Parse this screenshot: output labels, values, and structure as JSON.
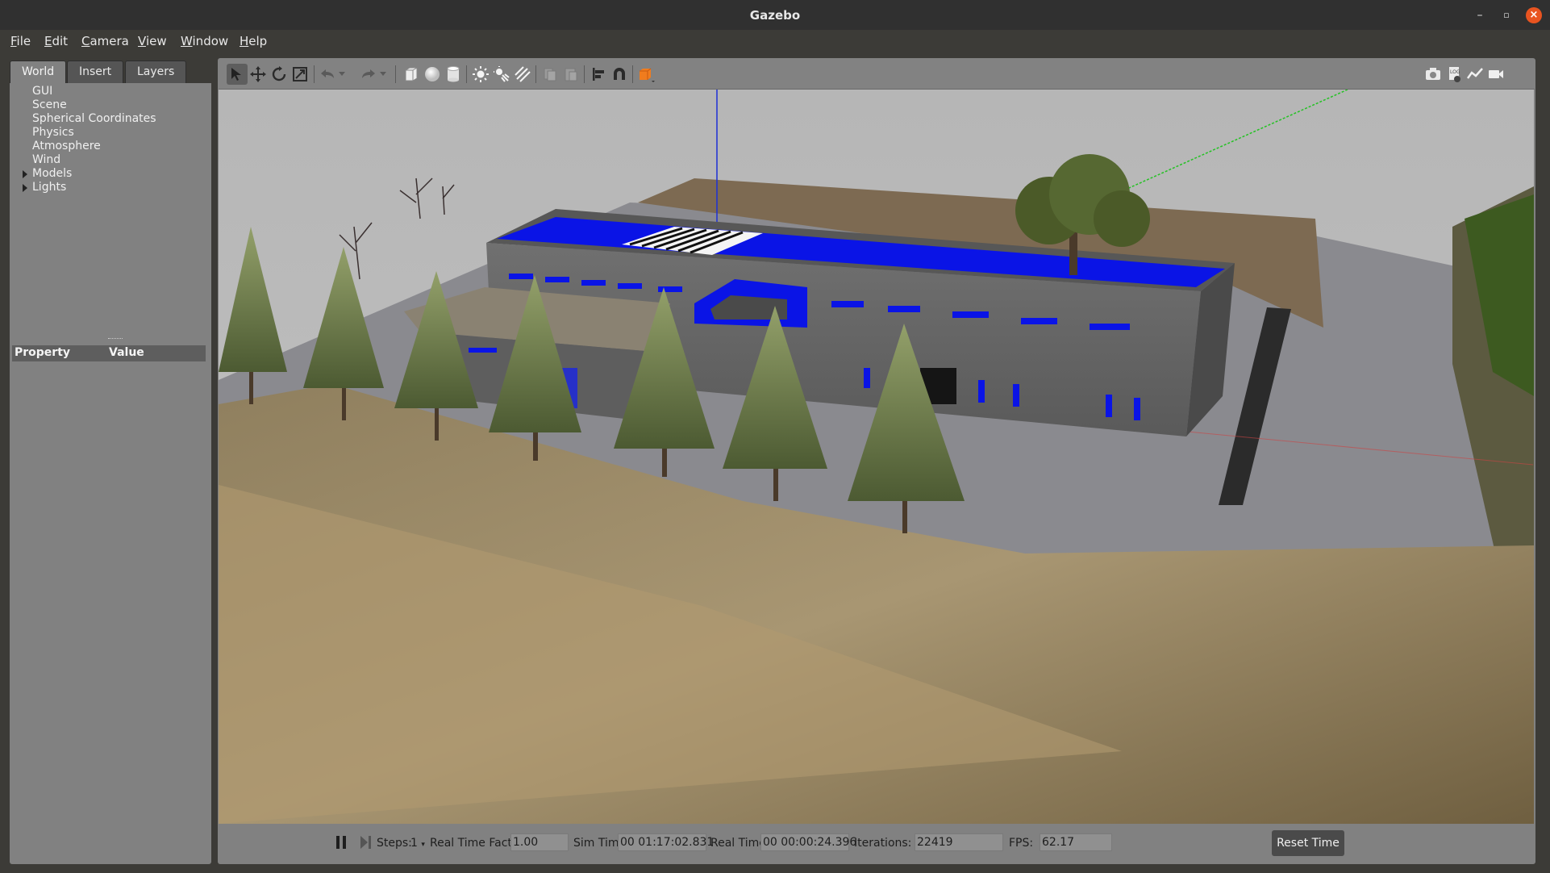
{
  "window": {
    "title": "Gazebo"
  },
  "menu": [
    "File",
    "Edit",
    "Camera",
    "View",
    "Window",
    "Help"
  ],
  "left_panel": {
    "tabs": [
      "World",
      "Insert",
      "Layers"
    ],
    "active_tab": "World",
    "tree": [
      {
        "label": "GUI",
        "expandable": false
      },
      {
        "label": "Scene",
        "expandable": false
      },
      {
        "label": "Spherical Coordinates",
        "expandable": false
      },
      {
        "label": "Physics",
        "expandable": false
      },
      {
        "label": "Atmosphere",
        "expandable": false
      },
      {
        "label": "Wind",
        "expandable": false
      },
      {
        "label": "Models",
        "expandable": true
      },
      {
        "label": "Lights",
        "expandable": true
      }
    ],
    "property_header": {
      "property": "Property",
      "value": "Value"
    }
  },
  "toolbar": {
    "tools": [
      "select-arrow-icon",
      "translate-icon",
      "rotate-icon",
      "scale-icon",
      "undo-icon",
      "redo-icon",
      "box-icon",
      "sphere-icon",
      "cylinder-icon",
      "point-light-icon",
      "spot-light-icon",
      "directional-light-icon",
      "copy-icon",
      "paste-icon",
      "align-icon",
      "magnet-snap-icon",
      "view-angle-icon"
    ],
    "right_tools": [
      "screenshot-icon",
      "log-icon",
      "plot-icon",
      "video-record-icon"
    ]
  },
  "status": {
    "steps_label": "Steps:",
    "steps_value": "1",
    "rtf_label": "Real Time Factor:",
    "rtf_value": "1.00",
    "sim_time_label": "Sim Time:",
    "sim_time_value": "00 01:17:02.831",
    "real_time_label": "Real Time:",
    "real_time_value": "00 00:00:24.396",
    "iterations_label": "Iterations:",
    "iterations_value": "22419",
    "fps_label": "FPS:",
    "fps_value": "62.17",
    "reset_label": "Reset Time"
  },
  "colors": {
    "titlebar": "#303030",
    "panel": "#818181",
    "close": "#e95420",
    "roof": "#0a14e6"
  }
}
